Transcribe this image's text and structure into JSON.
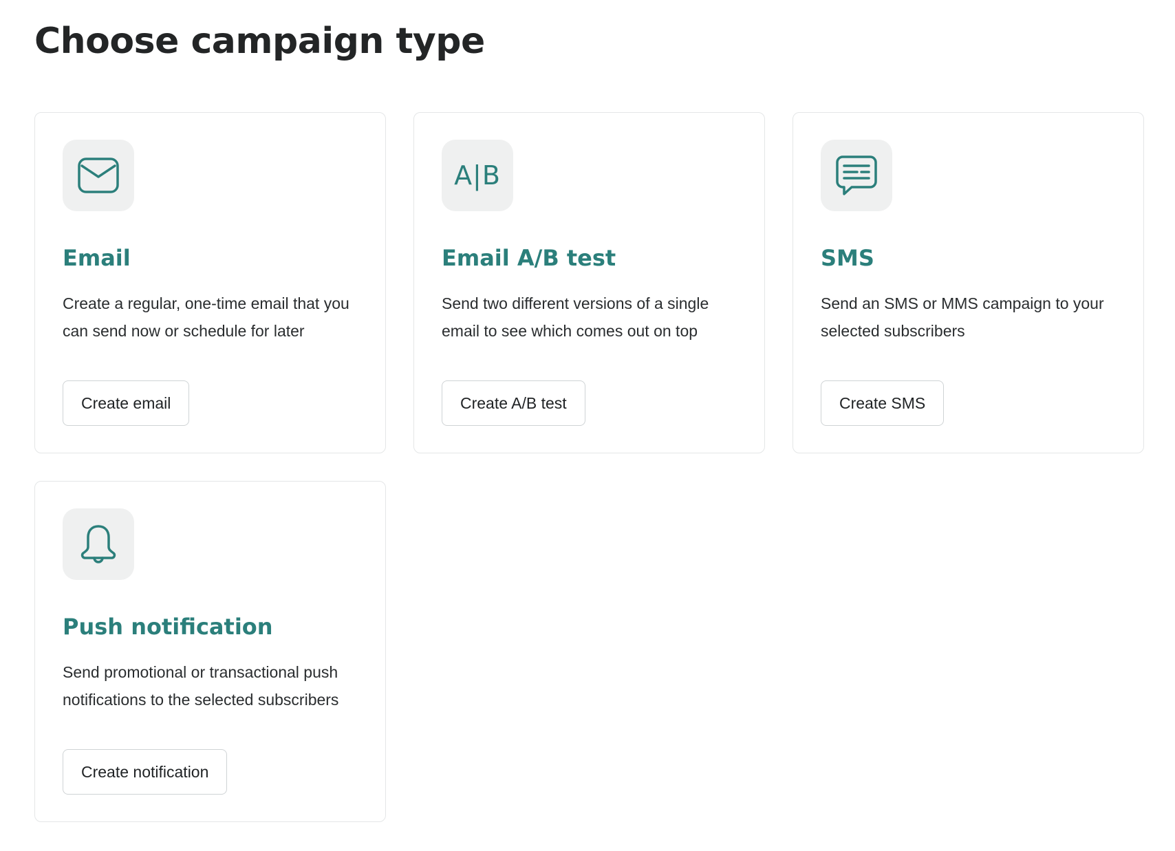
{
  "page": {
    "title": "Choose campaign type"
  },
  "colors": {
    "accent": "#2b7f7b",
    "icon_tile_bg": "#eff0f0",
    "card_border": "#e4e6e7"
  },
  "cards": [
    {
      "icon": "envelope-icon",
      "title": "Email",
      "description": "Create a regular, one-time email that you can send now or schedule for later",
      "button_label": "Create email"
    },
    {
      "icon": "ab-test-icon",
      "icon_text": "A|B",
      "title": "Email A/B test",
      "description": "Send two different versions of a single email to see which comes out on top",
      "button_label": "Create A/B test"
    },
    {
      "icon": "message-icon",
      "title": "SMS",
      "description": "Send an SMS or MMS campaign to your selected subscribers",
      "button_label": "Create SMS"
    },
    {
      "icon": "bell-icon",
      "title": "Push notification",
      "description": "Send promotional or transactional push notifications to the selected subscribers",
      "button_label": "Create notification"
    }
  ]
}
